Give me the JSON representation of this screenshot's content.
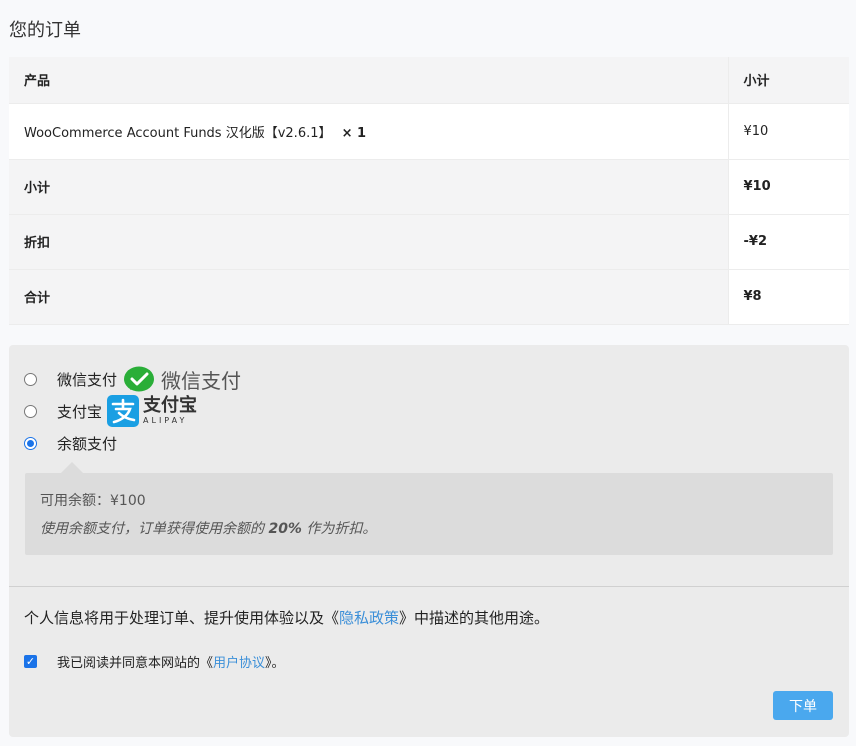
{
  "page": {
    "title": "您的订单"
  },
  "order_table": {
    "headers": {
      "product": "产品",
      "subtotal": "小计"
    },
    "item": {
      "name": "WooCommerce Account Funds 汉化版【v2.6.1】",
      "qty": "× 1",
      "price": "¥10"
    },
    "totals": [
      {
        "label": "小计",
        "value": "¥10"
      },
      {
        "label": "折扣",
        "value": "-¥2"
      },
      {
        "label": "合计",
        "value": "¥8"
      }
    ]
  },
  "payment": {
    "methods": [
      {
        "label": "微信支付",
        "logo_text": "微信支付",
        "selected": false
      },
      {
        "label": "支付宝",
        "logo_text": "支付宝",
        "logo_sub": "ALIPAY",
        "selected": false
      },
      {
        "label": "余额支付",
        "selected": true
      }
    ],
    "description": {
      "balance_label": "可用余额：",
      "balance_value": "¥100",
      "note_prefix": "使用余额支付，订单获得使用余额的 ",
      "note_percent": "20%",
      "note_suffix": " 作为折扣。"
    },
    "privacy": {
      "prefix": "个人信息将用于处理订单、提升使用体验以及《",
      "link": "隐私政策",
      "suffix": "》中描述的其他用途。"
    },
    "terms": {
      "prefix": "我已阅读并同意本网站的《",
      "link": "用户协议",
      "suffix": "》。",
      "checked": true
    },
    "submit_label": "下单"
  },
  "colors": {
    "accent": "#1a73e8",
    "button": "#4aa8ee",
    "link": "#3b8fd8",
    "wechat_green": "#2aae38",
    "alipay_blue": "#1a9fe3"
  },
  "icons": {
    "wechat": "wechat-icon",
    "alipay": "alipay-icon",
    "check": "checkmark-icon"
  }
}
